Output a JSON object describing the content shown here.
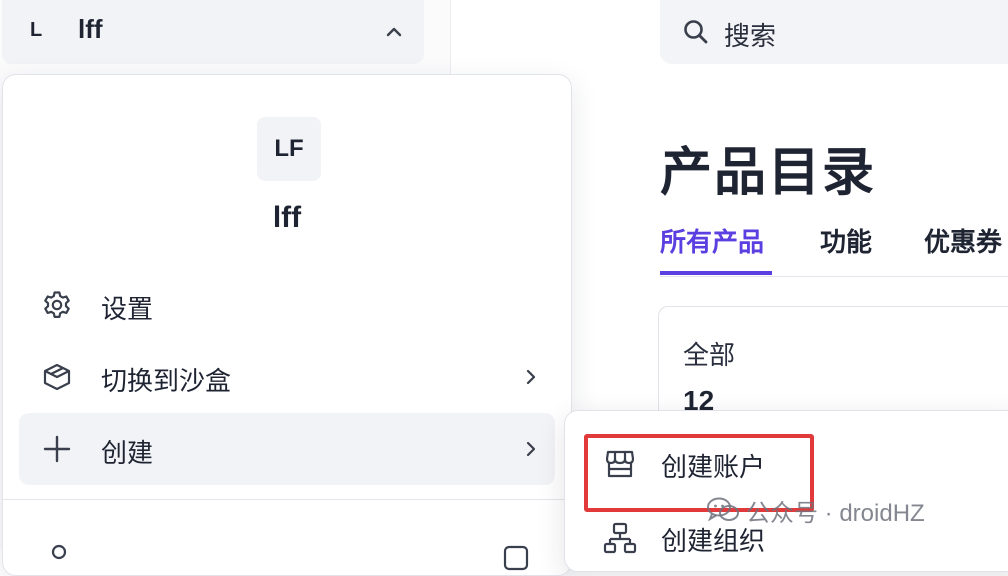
{
  "sidebar": {
    "account_initial": "L",
    "account_name": "lff"
  },
  "search": {
    "placeholder": "搜索"
  },
  "main": {
    "title": "产品目录",
    "tabs": [
      {
        "label": "所有产品",
        "active": true
      },
      {
        "label": "功能",
        "active": false
      },
      {
        "label": "优惠券",
        "active": false
      }
    ],
    "summary": {
      "label": "全部",
      "count": "12"
    }
  },
  "dropdown": {
    "avatar_initials": "LF",
    "account_name": "lff",
    "items": [
      {
        "label": "设置",
        "icon": "gear-icon",
        "has_submenu": false
      },
      {
        "label": "切换到沙盒",
        "icon": "sandbox-box-icon",
        "has_submenu": true
      },
      {
        "label": "创建",
        "icon": "plus-icon",
        "has_submenu": true
      }
    ]
  },
  "create_submenu": {
    "items": [
      {
        "label": "创建账户",
        "icon": "storefront-icon"
      },
      {
        "label": "创建组织",
        "icon": "org-chart-icon"
      }
    ]
  },
  "watermark": {
    "text": "公众号 · droidHZ"
  },
  "colors": {
    "accent": "#5b3fe0",
    "highlight": "#e23a3a",
    "text": "#1f2433"
  }
}
